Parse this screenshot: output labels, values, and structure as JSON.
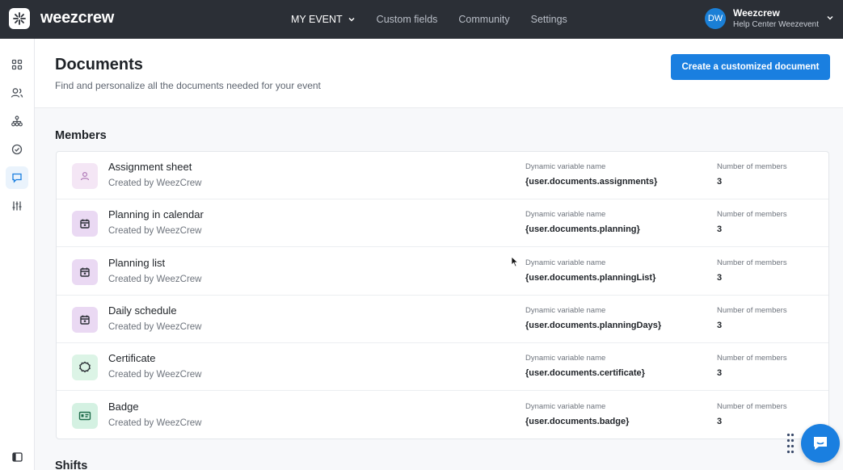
{
  "brand": {
    "name": "weezcrew",
    "logo_icon": "weezcrew-logo-icon"
  },
  "nav": {
    "items": [
      {
        "label": "MY EVENT",
        "active": true,
        "dropdown": true
      },
      {
        "label": "Custom fields"
      },
      {
        "label": "Community"
      },
      {
        "label": "Settings"
      }
    ]
  },
  "user": {
    "initials": "DW",
    "name": "Weezcrew",
    "subtitle": "Help Center Weezevent"
  },
  "sidebar": {
    "icons": [
      "dashboard-icon",
      "members-icon",
      "organization-icon",
      "tasks-check-icon",
      "documents-chat-icon",
      "settings-sliders-icon",
      "collapse-panel-icon"
    ],
    "active": "documents-chat-icon"
  },
  "header": {
    "title": "Documents",
    "subtitle": "Find and personalize all the documents needed for your event",
    "create_button": "Create a customized document"
  },
  "sections": {
    "members_title": "Members",
    "shifts_title": "Shifts"
  },
  "columns": {
    "variable_label": "Dynamic variable name",
    "members_label": "Number of members"
  },
  "documents": [
    {
      "name": "Assignment sheet",
      "creator": "Created by WeezCrew",
      "variable": "{user.documents.assignments}",
      "count": "3",
      "icon": "person-icon",
      "icon_bg": "#f4e6f5"
    },
    {
      "name": "Planning in calendar",
      "creator": "Created by WeezCrew",
      "variable": "{user.documents.planning}",
      "count": "3",
      "icon": "calendar-icon",
      "icon_bg": "#ead9f3"
    },
    {
      "name": "Planning list",
      "creator": "Created by WeezCrew",
      "variable": "{user.documents.planningList}",
      "count": "3",
      "icon": "calendar-icon",
      "icon_bg": "#ead9f3"
    },
    {
      "name": "Daily schedule",
      "creator": "Created by WeezCrew",
      "variable": "{user.documents.planningDays}",
      "count": "3",
      "icon": "calendar-icon",
      "icon_bg": "#ead9f3"
    },
    {
      "name": "Certificate",
      "creator": "Created by WeezCrew",
      "variable": "{user.documents.certificate}",
      "count": "3",
      "icon": "certificate-badge-icon",
      "icon_bg": "#dcf4e6"
    },
    {
      "name": "Badge",
      "creator": "Created by WeezCrew",
      "variable": "{user.documents.badge}",
      "count": "3",
      "icon": "id-card-icon",
      "icon_bg": "#d4f1e2"
    }
  ],
  "colors": {
    "accent": "#1a7fe0",
    "topbar": "#2b2f36"
  }
}
